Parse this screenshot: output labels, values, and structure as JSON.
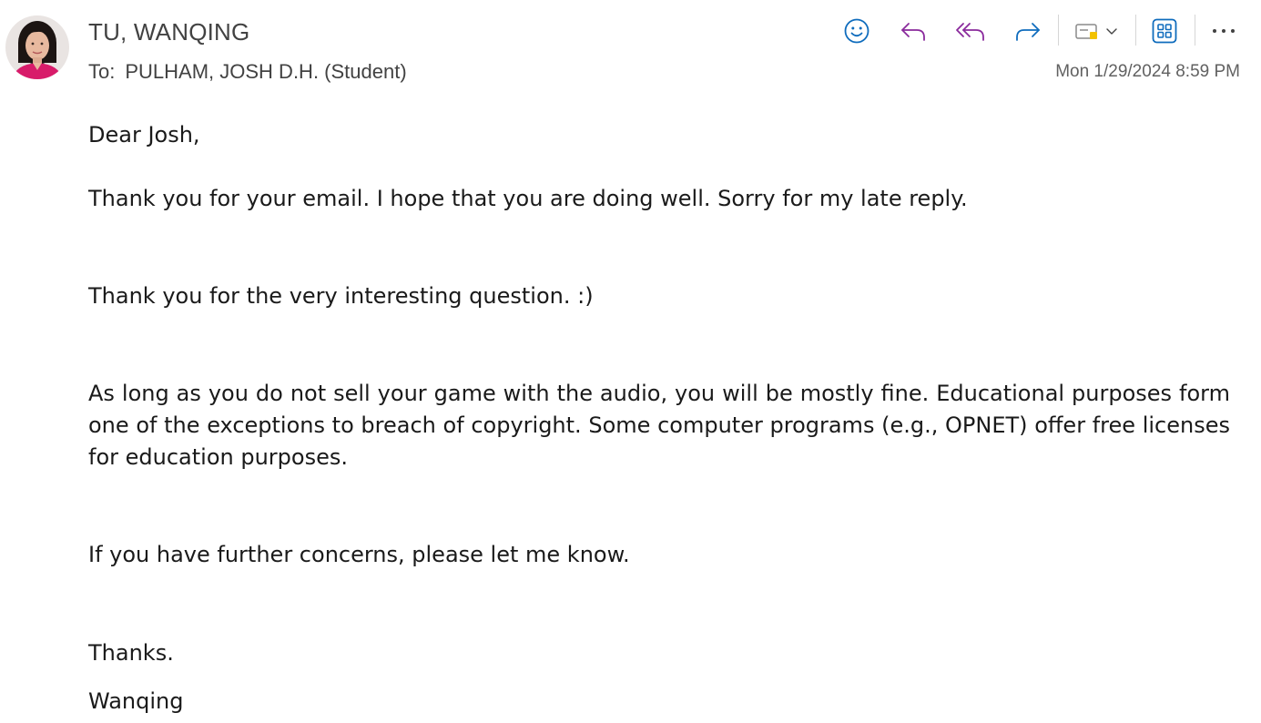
{
  "header": {
    "sender_name": "TU, WANQING",
    "to_label": "To:",
    "recipient": "PULHAM, JOSH D.H. (Student)",
    "timestamp": "Mon 1/29/2024 8:59 PM"
  },
  "toolbar": {
    "icons": [
      "emoji-react-icon",
      "reply-icon",
      "reply-all-icon",
      "forward-icon",
      "sensitivity-label-icon",
      "chevron-down-icon",
      "apps-icon",
      "more-options-icon"
    ],
    "colors": {
      "emoji": "#0f6cbd",
      "reply": "#8a2a9c",
      "forward": "#0f6cbd",
      "apps": "#0f6cbd",
      "more": "#424242"
    }
  },
  "message": {
    "greeting": "Dear Josh,",
    "paragraphs": [
      "Thank you for your email. I hope that you are doing well. Sorry for my late reply.",
      "Thank you for the very interesting question. :)",
      "As long as you do not sell your game with the audio, you will be mostly fine. Educational purposes form one of the exceptions to breach of copyright. Some computer programs (e.g., OPNET) offer free licenses for education purposes.",
      "If you have further concerns, please let me know."
    ],
    "signoff": "Thanks.",
    "signature": "Wanqing"
  }
}
